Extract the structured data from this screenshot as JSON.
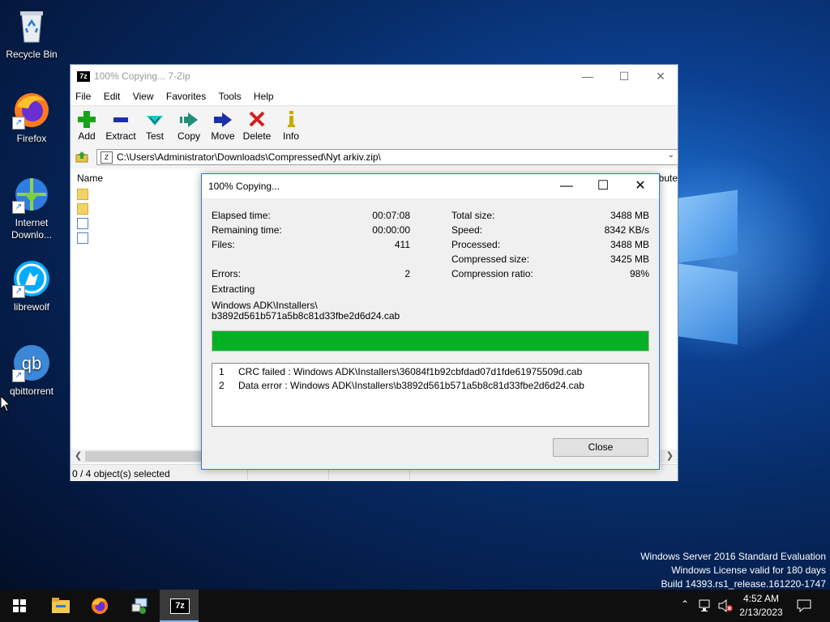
{
  "desktop": {
    "icons": [
      {
        "label": "Recycle Bin",
        "icon": "recycle-bin-icon"
      },
      {
        "label": "Firefox",
        "icon": "firefox-icon"
      },
      {
        "label": "Internet Downlo...",
        "icon": "internet-download-manager-icon"
      },
      {
        "label": "librewolf",
        "icon": "librewolf-icon"
      },
      {
        "label": "qbittorrent",
        "icon": "qbittorrent-icon"
      }
    ],
    "watermark": [
      "Windows Server 2016 Standard Evaluation",
      "Windows License valid for 180 days",
      "Build 14393.rs1_release.161220-1747"
    ]
  },
  "main_window": {
    "title": "100% Copying... 7-Zip",
    "app_icon_text": "7z",
    "menu": [
      "File",
      "Edit",
      "View",
      "Favorites",
      "Tools",
      "Help"
    ],
    "toolbar": [
      {
        "label": "Add",
        "icon": "add-plus-icon",
        "color": "#1aa31a"
      },
      {
        "label": "Extract",
        "icon": "extract-minus-icon",
        "color": "#1b2fa8"
      },
      {
        "label": "Test",
        "icon": "test-check-icon",
        "color": "#12a3a3"
      },
      {
        "label": "Copy",
        "icon": "copy-arrow-icon",
        "color": "#1f8f7a"
      },
      {
        "label": "Move",
        "icon": "move-arrow-icon",
        "color": "#1b2fa8"
      },
      {
        "label": "Delete",
        "icon": "delete-x-icon",
        "color": "#d21f1f"
      },
      {
        "label": "Info",
        "icon": "info-icon",
        "color": "#c9a800"
      }
    ],
    "address": "C:\\Users\\Administrator\\Downloads\\Compressed\\Nyt arkiv.zip\\",
    "columns": {
      "name": "Name",
      "attributes_partial": "bute"
    },
    "status": "0 / 4 object(s) selected"
  },
  "progress_dialog": {
    "title": "100% Copying...",
    "left_stats": [
      {
        "label": "Elapsed time:",
        "value": "00:07:08"
      },
      {
        "label": "Remaining time:",
        "value": "00:00:00"
      },
      {
        "label": "Files:",
        "value": "411"
      },
      {
        "label": "Errors:",
        "value": "2"
      }
    ],
    "right_stats": [
      {
        "label": "Total size:",
        "value": "3488 MB"
      },
      {
        "label": "Speed:",
        "value": "8342 KB/s"
      },
      {
        "label": "Processed:",
        "value": "3488 MB"
      },
      {
        "label": "Compressed size:",
        "value": "3425 MB"
      },
      {
        "label": "Compression ratio:",
        "value": "98%"
      }
    ],
    "operation": "Extracting",
    "current_path_line1": "Windows ADK\\Installers\\",
    "current_path_line2": "b3892d561b571a5b8c81d33fbe2d6d24.cab",
    "progress_percent": 100,
    "progress_color": "#06b025",
    "errors": [
      {
        "num": "1",
        "text": "CRC failed : Windows ADK\\Installers\\36084f1b92cbfdad07d1fde61975509d.cab"
      },
      {
        "num": "2",
        "text": "Data error : Windows ADK\\Installers\\b3892d561b571a5b8c81d33fbe2d6d24.cab"
      }
    ],
    "close_label": "Close"
  },
  "taskbar": {
    "items": [
      "start-icon",
      "file-explorer-icon",
      "firefox-icon",
      "network-tool-icon",
      "7zip-icon"
    ],
    "time": "4:52 AM",
    "date": "2/13/2023"
  }
}
